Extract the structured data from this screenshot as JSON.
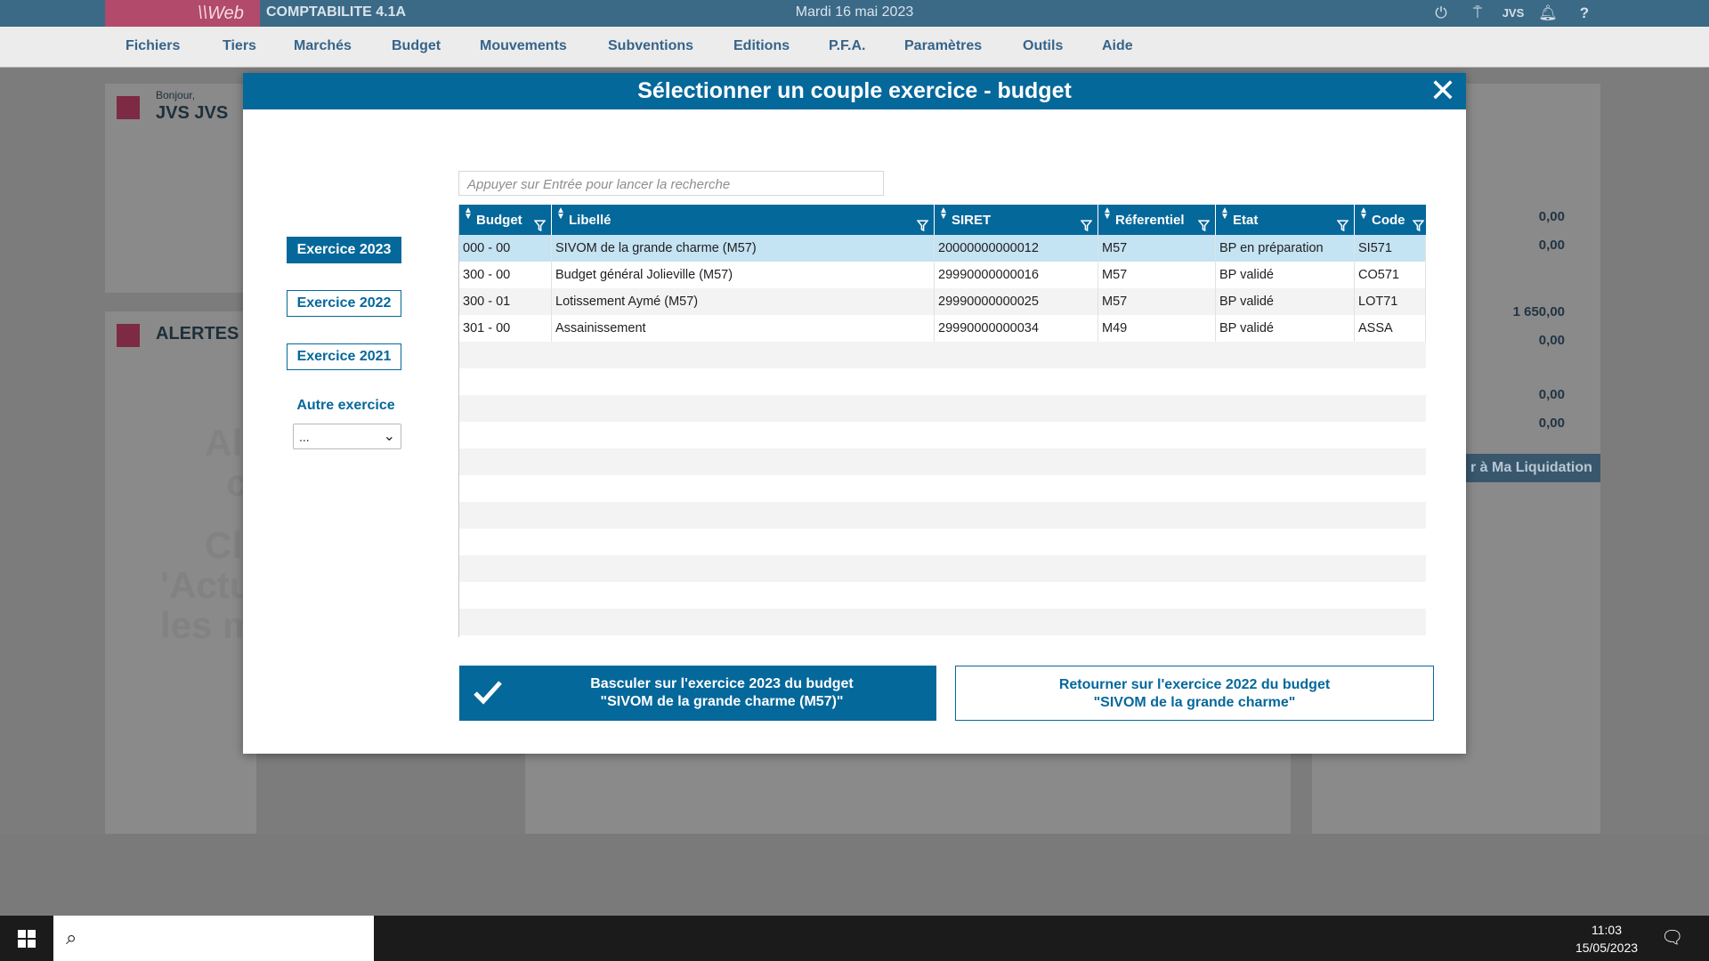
{
  "topbar": {
    "brand": "\\\\Web",
    "app_title": "COMPTABILITE 4.1A",
    "date": "Mardi 16 mai 2023",
    "icons": [
      "power-icon",
      "network-icon",
      "jvs-icon",
      "bell-icon",
      "help-icon"
    ]
  },
  "menu": [
    "Fichiers",
    "Tiers",
    "Marchés",
    "Budget",
    "Mouvements",
    "Subventions",
    "Editions",
    "P.F.A.",
    "Paramètres",
    "Outils",
    "Aide"
  ],
  "background": {
    "greeting": "Bonjour,",
    "user": "JVS JVS",
    "alerts_title": "ALERTES",
    "faint_lines": [
      "Al",
      "c",
      "Cl",
      "'Actu",
      "les m"
    ],
    "numbers": [
      "0,00",
      "0,00",
      "1 650,00",
      "0,00",
      "0,00",
      "0,00"
    ],
    "liquidation_btn": "r à Ma Liquidation"
  },
  "modal": {
    "title": "Sélectionner un couple exercice - budget",
    "exercise_buttons": [
      "Exercice 2023",
      "Exercice 2022",
      "Exercice 2021"
    ],
    "active_exercise": "Exercice 2023",
    "other_label": "Autre exercice",
    "other_select_value": "...",
    "search_placeholder": "Appuyer sur Entrée pour lancer la recherche",
    "columns": [
      "Budget",
      "Libellé",
      "SIRET",
      "Réferentiel",
      "Etat",
      "Code"
    ],
    "rows": [
      {
        "budget": "000 - 00",
        "libelle": "SIVOM de la grande charme (M57)",
        "siret": "20000000000012",
        "referentiel": "M57",
        "etat": "BP en préparation",
        "code": "SI571"
      },
      {
        "budget": "300 - 00",
        "libelle": "Budget général Jolieville (M57)",
        "siret": "29990000000016",
        "referentiel": "M57",
        "etat": "BP validé",
        "code": "CO571"
      },
      {
        "budget": "300 - 01",
        "libelle": "Lotissement Aymé (M57)",
        "siret": "29990000000025",
        "referentiel": "M57",
        "etat": "BP validé",
        "code": "LOT71"
      },
      {
        "budget": "301 - 00",
        "libelle": "Assainissement",
        "siret": "29990000000034",
        "referentiel": "M49",
        "etat": "BP validé",
        "code": "ASSA"
      }
    ],
    "confirm_button": {
      "line1": "Basculer sur l'exercice 2023 du budget",
      "line2": "\"SIVOM de la grande charme (M57)\""
    },
    "return_button": {
      "line1": "Retourner sur l'exercice 2022 du budget",
      "line2": "\"SIVOM de la grande charme\""
    }
  },
  "taskbar": {
    "time": "11:03",
    "date": "15/05/2023"
  },
  "colors": {
    "primary": "#05689b",
    "topbar": "#3b6a87",
    "brand": "#b24a6c",
    "selected_row": "#c4e3f3"
  }
}
